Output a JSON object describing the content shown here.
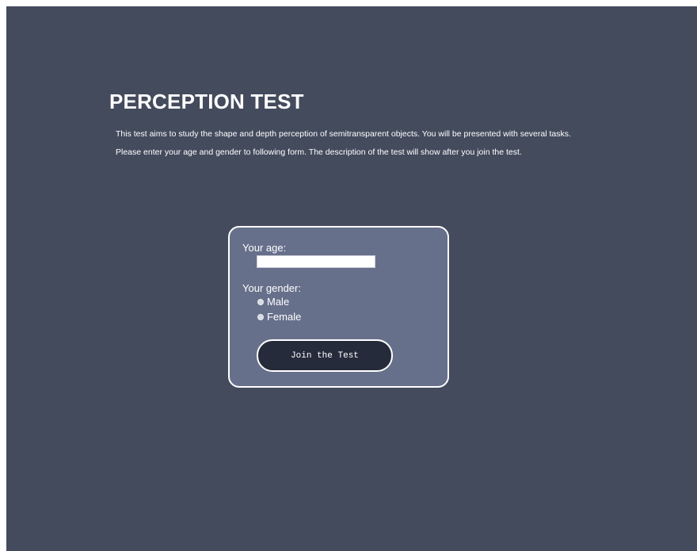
{
  "page": {
    "title": "PERCEPTION TEST",
    "description_line1": "This test aims to study the shape and depth perception of semitransparent objects. You will be presented with several tasks.",
    "description_line2": "Please enter your age and gender to following form. The description of the test will show after you join the test."
  },
  "form": {
    "age_label": "Your age:",
    "age_value": "",
    "gender_label": "Your gender:",
    "gender_options": [
      "Male",
      "Female"
    ],
    "gender_selected": "",
    "submit_label": "Join the Test"
  },
  "colors": {
    "background": "#444b5d",
    "form_background": "#67708b",
    "button_background": "#252b3b",
    "text": "#ffffff"
  }
}
